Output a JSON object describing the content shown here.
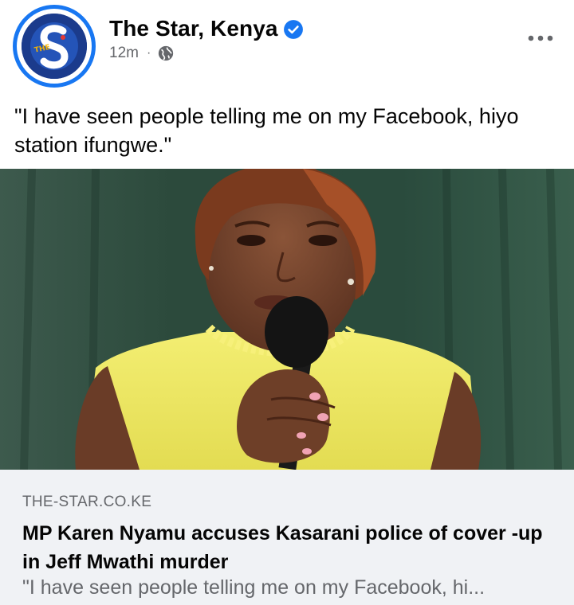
{
  "post": {
    "page_name": "The Star, Kenya",
    "verified": true,
    "time": "12m",
    "separator": "·",
    "audience_icon": "globe-icon",
    "more_icon": "more-options-icon",
    "caption": "\"I have seen people telling me on my Facebook, hiyo station ifungwe.\""
  },
  "link": {
    "domain": "THE-STAR.CO.KE",
    "headline": "MP Karen Nyamu accuses Kasarani police of cover -up in Jeff Mwathi murder",
    "snippet": "\"I have seen people telling me on my Facebook, hi..."
  },
  "colors": {
    "accent": "#1877f2",
    "text_primary": "#050505",
    "text_secondary": "#65676b",
    "preview_bg": "#f0f2f5"
  }
}
